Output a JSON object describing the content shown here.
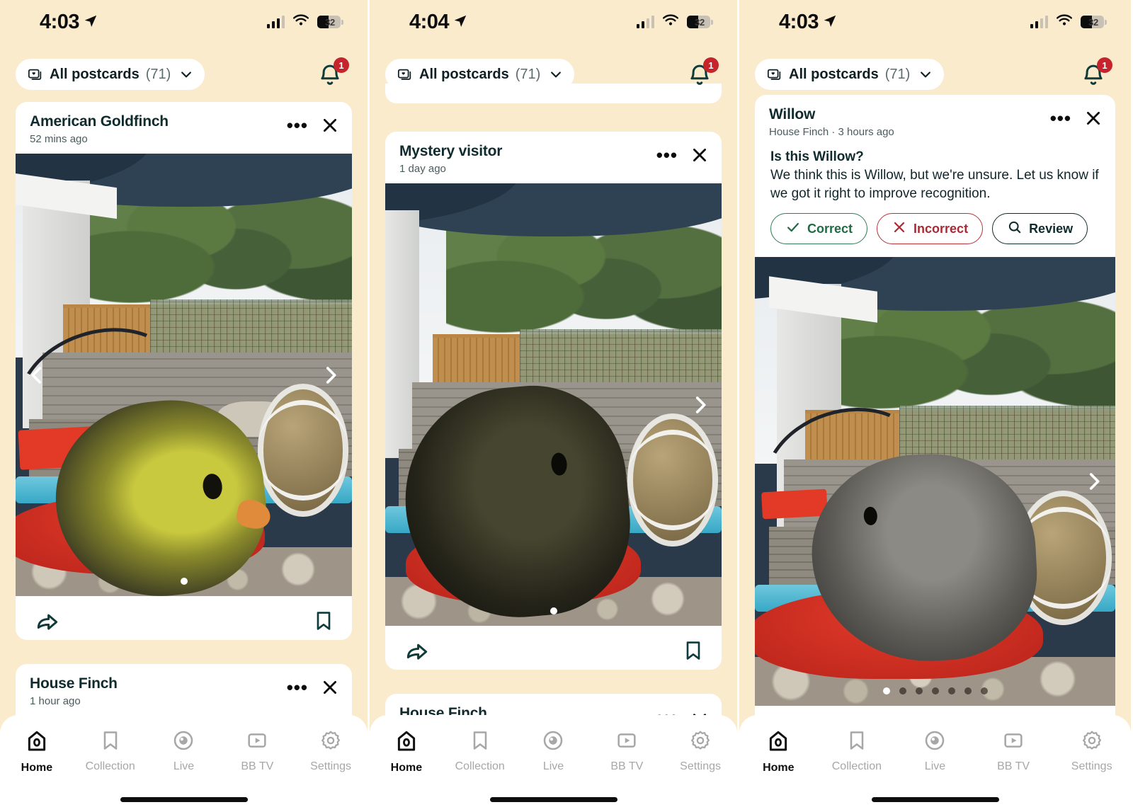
{
  "app": {
    "background_color": "#FBEBCD",
    "accent_dark": "#0F2B2E",
    "badge_color": "#C5242C"
  },
  "panels": [
    {
      "id": "panel-1",
      "status_bar": {
        "time": "4:03",
        "battery": "32",
        "location_icon": "location-arrow-icon",
        "signal_icon": "cellular-bars-icon",
        "wifi_icon": "wifi-icon"
      },
      "top_bar": {
        "filter_label": "All postcards",
        "filter_count": "(71)",
        "filter_icon": "postcards-icon",
        "chevron_icon": "chevron-down-icon",
        "bell_icon": "bell-icon",
        "bell_badge": "1"
      },
      "cards": [
        {
          "title": "American Goldfinch",
          "subtitle": "52 mins ago",
          "menu_icon": "more-options-icon",
          "close_icon": "close-icon",
          "dots_total": 1,
          "dots_active": 0,
          "has_left_arrow": true,
          "has_right_arrow": true,
          "share_icon": "share-icon",
          "bookmark_icon": "bookmark-icon"
        },
        {
          "title": "House Finch",
          "subtitle": "1 hour ago",
          "menu_icon": "more-options-icon",
          "close_icon": "close-icon"
        }
      ],
      "tabs": [
        {
          "label": "Home",
          "icon": "birdhouse-icon",
          "active": true
        },
        {
          "label": "Collection",
          "icon": "bookmark-icon",
          "active": false
        },
        {
          "label": "Live",
          "icon": "live-camera-icon",
          "active": false
        },
        {
          "label": "BB TV",
          "icon": "play-box-icon",
          "active": false
        },
        {
          "label": "Settings",
          "icon": "gear-icon",
          "active": false
        }
      ]
    },
    {
      "id": "panel-2",
      "status_bar": {
        "time": "4:04",
        "battery": "32",
        "location_icon": "location-arrow-icon",
        "signal_icon": "cellular-bars-icon",
        "wifi_icon": "wifi-icon"
      },
      "top_bar": {
        "filter_label": "All postcards",
        "filter_count": "(71)",
        "filter_icon": "postcards-icon",
        "chevron_icon": "chevron-down-icon",
        "bell_icon": "bell-icon",
        "bell_badge": "1"
      },
      "cards": [
        {
          "title": "Mystery visitor",
          "subtitle": "1 day ago",
          "menu_icon": "more-options-icon",
          "close_icon": "close-icon",
          "dots_total": 1,
          "dots_active": 0,
          "has_left_arrow": false,
          "has_right_arrow": true,
          "share_icon": "share-icon",
          "bookmark_icon": "bookmark-icon"
        },
        {
          "title": "House Finch",
          "subtitle": "",
          "menu_icon": "more-options-icon",
          "close_icon": "chevron-down-icon"
        }
      ],
      "tabs": [
        {
          "label": "Home",
          "icon": "birdhouse-icon",
          "active": true
        },
        {
          "label": "Collection",
          "icon": "bookmark-icon",
          "active": false
        },
        {
          "label": "Live",
          "icon": "live-camera-icon",
          "active": false
        },
        {
          "label": "BB TV",
          "icon": "play-box-icon",
          "active": false
        },
        {
          "label": "Settings",
          "icon": "gear-icon",
          "active": false
        }
      ]
    },
    {
      "id": "panel-3",
      "status_bar": {
        "time": "4:03",
        "battery": "32",
        "location_icon": "location-arrow-icon",
        "signal_icon": "cellular-bars-icon",
        "wifi_icon": "wifi-icon"
      },
      "top_bar": {
        "filter_label": "All postcards",
        "filter_count": "(71)",
        "filter_icon": "postcards-icon",
        "chevron_icon": "chevron-down-icon",
        "bell_icon": "bell-icon",
        "bell_badge": "1"
      },
      "cards": [
        {
          "title": "Willow",
          "subtitle": "House Finch · 3 hours ago",
          "menu_icon": "more-options-icon",
          "close_icon": "close-icon",
          "confirm": {
            "heading": "Is this Willow?",
            "body": "We think this is Willow, but we're unsure. Let us know if we got it right to improve recognition.",
            "buttons": [
              {
                "label": "Correct",
                "icon": "check-icon",
                "style": "ok"
              },
              {
                "label": "Incorrect",
                "icon": "x-icon",
                "style": "no"
              },
              {
                "label": "Review",
                "icon": "search-icon",
                "style": "rv"
              }
            ]
          },
          "dots_total": 7,
          "dots_active": 0,
          "has_left_arrow": false,
          "has_right_arrow": true,
          "share_icon": "share-icon",
          "bookmark_icon": "bookmark-icon"
        }
      ],
      "tabs": [
        {
          "label": "Home",
          "icon": "birdhouse-icon",
          "active": true
        },
        {
          "label": "Collection",
          "icon": "bookmark-icon",
          "active": false
        },
        {
          "label": "Live",
          "icon": "live-camera-icon",
          "active": false
        },
        {
          "label": "BB TV",
          "icon": "play-box-icon",
          "active": false
        },
        {
          "label": "Settings",
          "icon": "gear-icon",
          "active": false
        }
      ]
    }
  ]
}
